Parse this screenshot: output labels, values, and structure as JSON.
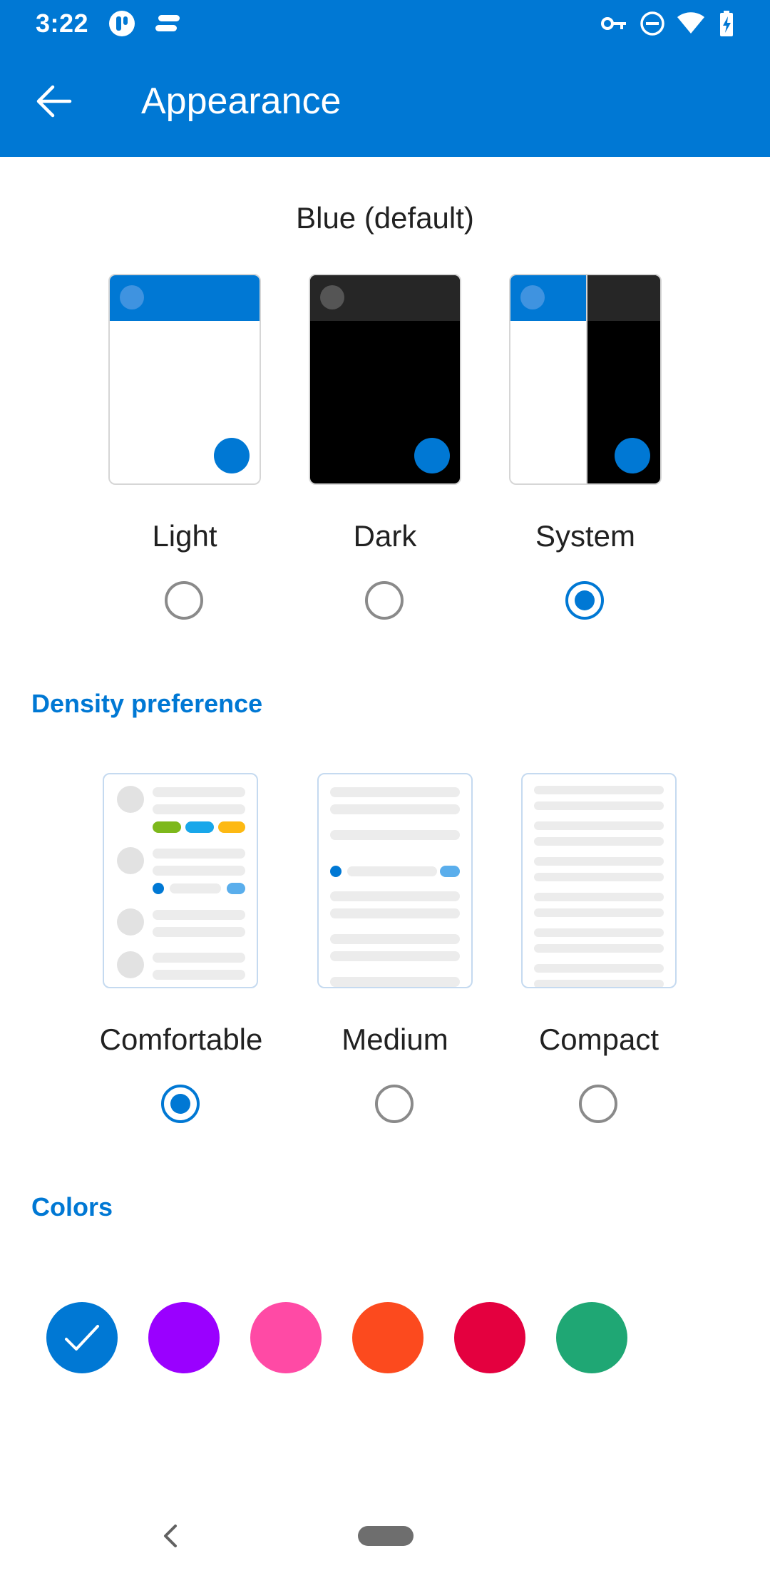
{
  "status_bar": {
    "time": "3:22",
    "left_icons": [
      "app-notification-icon",
      "app-notification-icon-2"
    ],
    "right_icons": [
      "vpn-key-icon",
      "do-not-disturb-icon",
      "wifi-icon",
      "battery-charging-icon"
    ]
  },
  "app_bar": {
    "title": "Appearance",
    "back_icon": "arrow-left-icon"
  },
  "theme": {
    "title": "Blue (default)",
    "options": [
      {
        "label": "Light",
        "selected": false
      },
      {
        "label": "Dark",
        "selected": false
      },
      {
        "label": "System",
        "selected": true
      }
    ]
  },
  "density": {
    "header": "Density preference",
    "options": [
      {
        "label": "Comfortable",
        "selected": true
      },
      {
        "label": "Medium",
        "selected": false
      },
      {
        "label": "Compact",
        "selected": false
      }
    ]
  },
  "colors": {
    "header": "Colors",
    "swatches": [
      {
        "name": "blue",
        "hex": "#0078d4",
        "selected": true
      },
      {
        "name": "purple",
        "hex": "#9a00ff",
        "selected": false
      },
      {
        "name": "pink",
        "hex": "#ff4aa5",
        "selected": false
      },
      {
        "name": "orange",
        "hex": "#fc4a1e",
        "selected": false
      },
      {
        "name": "red",
        "hex": "#e4003f",
        "selected": false
      },
      {
        "name": "green",
        "hex": "#1fa774",
        "selected": false
      }
    ]
  },
  "accent_color": "#0078d4",
  "nav_bar": {
    "back_icon": "nav-back-icon",
    "home_icon": "home-pill-icon"
  }
}
